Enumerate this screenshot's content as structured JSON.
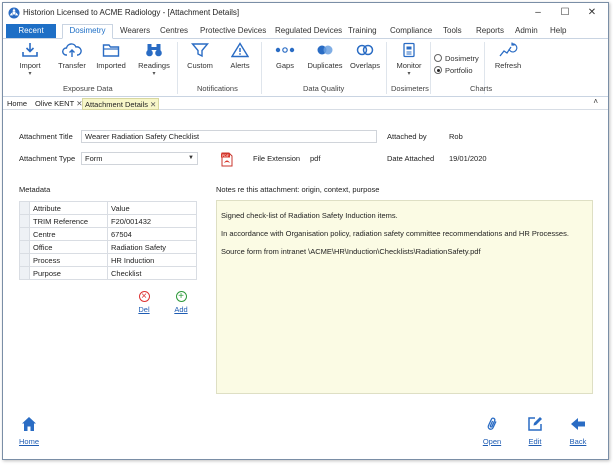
{
  "window": {
    "title": "Historion Licensed to ACME Radiology - [Attachment Details]",
    "controls": {
      "minimize": "–",
      "maximize": "☐",
      "close": "✕"
    }
  },
  "menu": {
    "recent": "Recent",
    "tabs": [
      "Dosimetry",
      "Wearers",
      "Centres",
      "Protective Devices",
      "Regulated Devices",
      "Training",
      "Compliance",
      "Tools",
      "Reports",
      "Admin",
      "Help"
    ],
    "active_tab": "Dosimetry"
  },
  "ribbon": {
    "buttons": {
      "import": "Import",
      "transfer": "Transfer",
      "imported": "Imported",
      "readings": "Readings",
      "custom": "Custom",
      "alerts": "Alerts",
      "gaps": "Gaps",
      "duplicates": "Duplicates",
      "overlaps": "Overlaps",
      "monitor": "Monitor",
      "refresh": "Refresh"
    },
    "groups": {
      "exposure_data": "Exposure Data",
      "notifications": "Notifications",
      "data_quality": "Data Quality",
      "dosimeters": "Dosimeters",
      "charts": "Charts"
    },
    "chart_options": {
      "dosimetry": "Dosimetry",
      "portfolio": "Portfolio",
      "selected": "Portfolio"
    }
  },
  "doc_tabs": {
    "home": "Home",
    "person": "Olive KENT",
    "attachment": "Attachment Details",
    "close_glyph": "✕",
    "collapse_glyph": "˄"
  },
  "form": {
    "title_label": "Attachment Title",
    "title_value": "Wearer Radiation Safety Checklist",
    "type_label": "Attachment Type",
    "type_value": "Form",
    "file_ext_label": "File Extension",
    "file_ext_value": "pdf",
    "attached_by_label": "Attached by",
    "attached_by_value": "Rob",
    "date_attached_label": "Date Attached",
    "date_attached_value": "19/01/2020",
    "pdf_badge": "PDF"
  },
  "metadata": {
    "heading": "Metadata",
    "columns": [
      "Attribute",
      "Value"
    ],
    "rows": [
      [
        "TRIM Reference",
        "F20/001432"
      ],
      [
        "Centre",
        "67504"
      ],
      [
        "Office",
        "Radiation Safety"
      ],
      [
        "Process",
        "HR Induction"
      ],
      [
        "Purpose",
        "Checklist"
      ]
    ],
    "del_label": "Del",
    "add_label": "Add"
  },
  "notes": {
    "heading": "Notes re this attachment: origin, context, purpose",
    "lines": [
      "Signed check-list of Radiation Safety Induction items.",
      "In accordance with Organisation policy, radiation safety committee recommendations and HR Processes.",
      "Source form from intranet \\ACME\\HR\\Induction\\Checklists\\RadiationSafety.pdf"
    ]
  },
  "footer": {
    "home": "Home",
    "open": "Open",
    "edit": "Edit",
    "back": "Back"
  },
  "colors": {
    "accent": "#1e6fc6",
    "notes_bg": "#fbfbe4",
    "active_tab_bg": "#f7f6c8",
    "link": "#1e5cb3"
  }
}
